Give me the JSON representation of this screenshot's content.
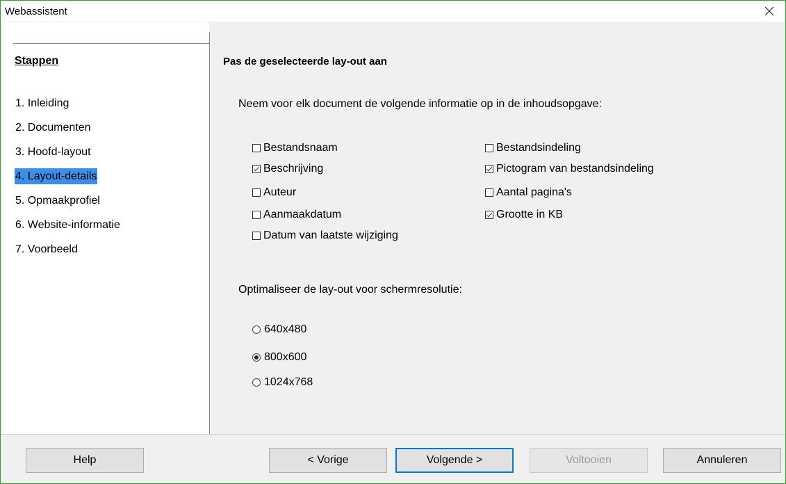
{
  "window": {
    "title": "Webassistent"
  },
  "steps": {
    "heading": "Stappen",
    "items": [
      {
        "label": "1. Inleiding"
      },
      {
        "label": "2. Documenten"
      },
      {
        "label": "3. Hoofd-layout"
      },
      {
        "label": "4. Layout-details",
        "active": true
      },
      {
        "label": "5. Opmaakprofiel"
      },
      {
        "label": "6. Website-informatie"
      },
      {
        "label": "7. Voorbeeld"
      }
    ]
  },
  "content": {
    "title": "Pas de geselecteerde lay-out aan",
    "intro": "Neem voor elk document de volgende informatie op in de inhoudsopgave:",
    "checkboxes": [
      {
        "label": "Bestandsnaam",
        "checked": false
      },
      {
        "label": "Beschrijving",
        "checked": true
      },
      {
        "label": "Auteur",
        "checked": false
      },
      {
        "label": "Aanmaakdatum",
        "checked": false
      },
      {
        "label": "Datum van laatste wijziging",
        "checked": false
      },
      {
        "label": "Bestandsindeling",
        "checked": false
      },
      {
        "label": "Pictogram van bestandsindeling",
        "checked": true
      },
      {
        "label": "Aantal pagina's",
        "checked": false
      },
      {
        "label": "Grootte in KB",
        "checked": true
      }
    ],
    "resolution_label": "Optimaliseer de lay-out voor schermresolutie:",
    "resolutions": [
      {
        "label": "640x480",
        "checked": false
      },
      {
        "label": "800x600",
        "checked": true
      },
      {
        "label": "1024x768",
        "checked": false
      }
    ]
  },
  "buttons": {
    "help": "Help",
    "previous": "< Vorige",
    "next": "Volgende >",
    "finish": "Voltooien",
    "cancel": "Annuleren"
  }
}
